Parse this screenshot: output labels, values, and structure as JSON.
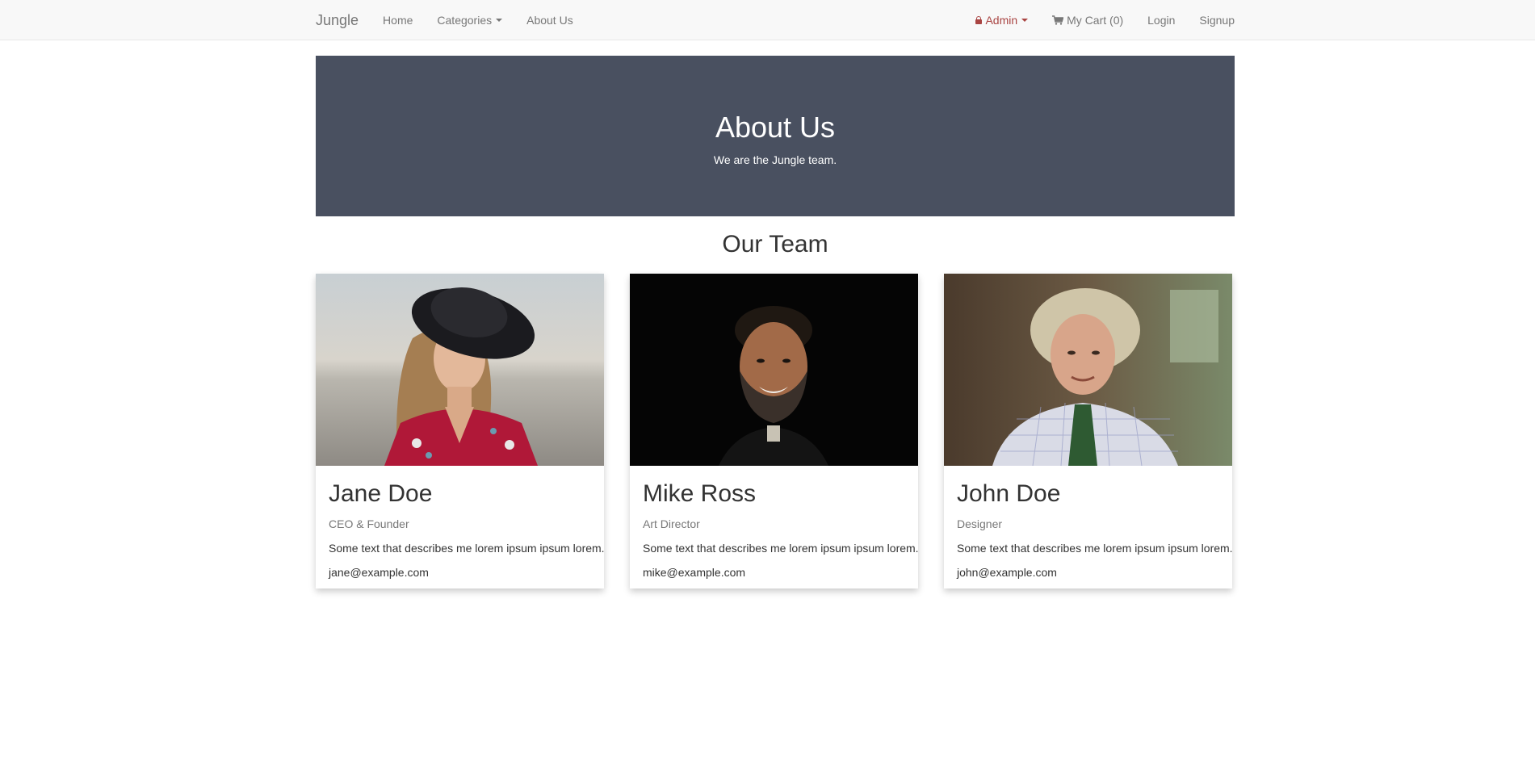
{
  "navbar": {
    "brand": "Jungle",
    "left_items": [
      {
        "label": "Home"
      },
      {
        "label": "Categories",
        "dropdown": true
      },
      {
        "label": "About Us"
      }
    ],
    "right_items": {
      "admin": "Admin",
      "cart": "My Cart (0)",
      "login": "Login",
      "signup": "Signup"
    }
  },
  "hero": {
    "title": "About Us",
    "subtitle": "We are the Jungle team.",
    "background": "#495060"
  },
  "team": {
    "title": "Our Team",
    "members": [
      {
        "name": "Jane Doe",
        "role": "CEO & Founder",
        "description": "Some text that describes me lorem ipsum ipsum lorem.",
        "email": "jane@example.com"
      },
      {
        "name": "Mike Ross",
        "role": "Art Director",
        "description": "Some text that describes me lorem ipsum ipsum lorem.",
        "email": "mike@example.com"
      },
      {
        "name": "John Doe",
        "role": "Designer",
        "description": "Some text that describes me lorem ipsum ipsum lorem.",
        "email": "john@example.com"
      }
    ]
  },
  "colors": {
    "navbar_bg": "#f8f8f8",
    "nav_text": "#777777",
    "admin_text": "#a94442",
    "hero_bg": "#495060"
  }
}
